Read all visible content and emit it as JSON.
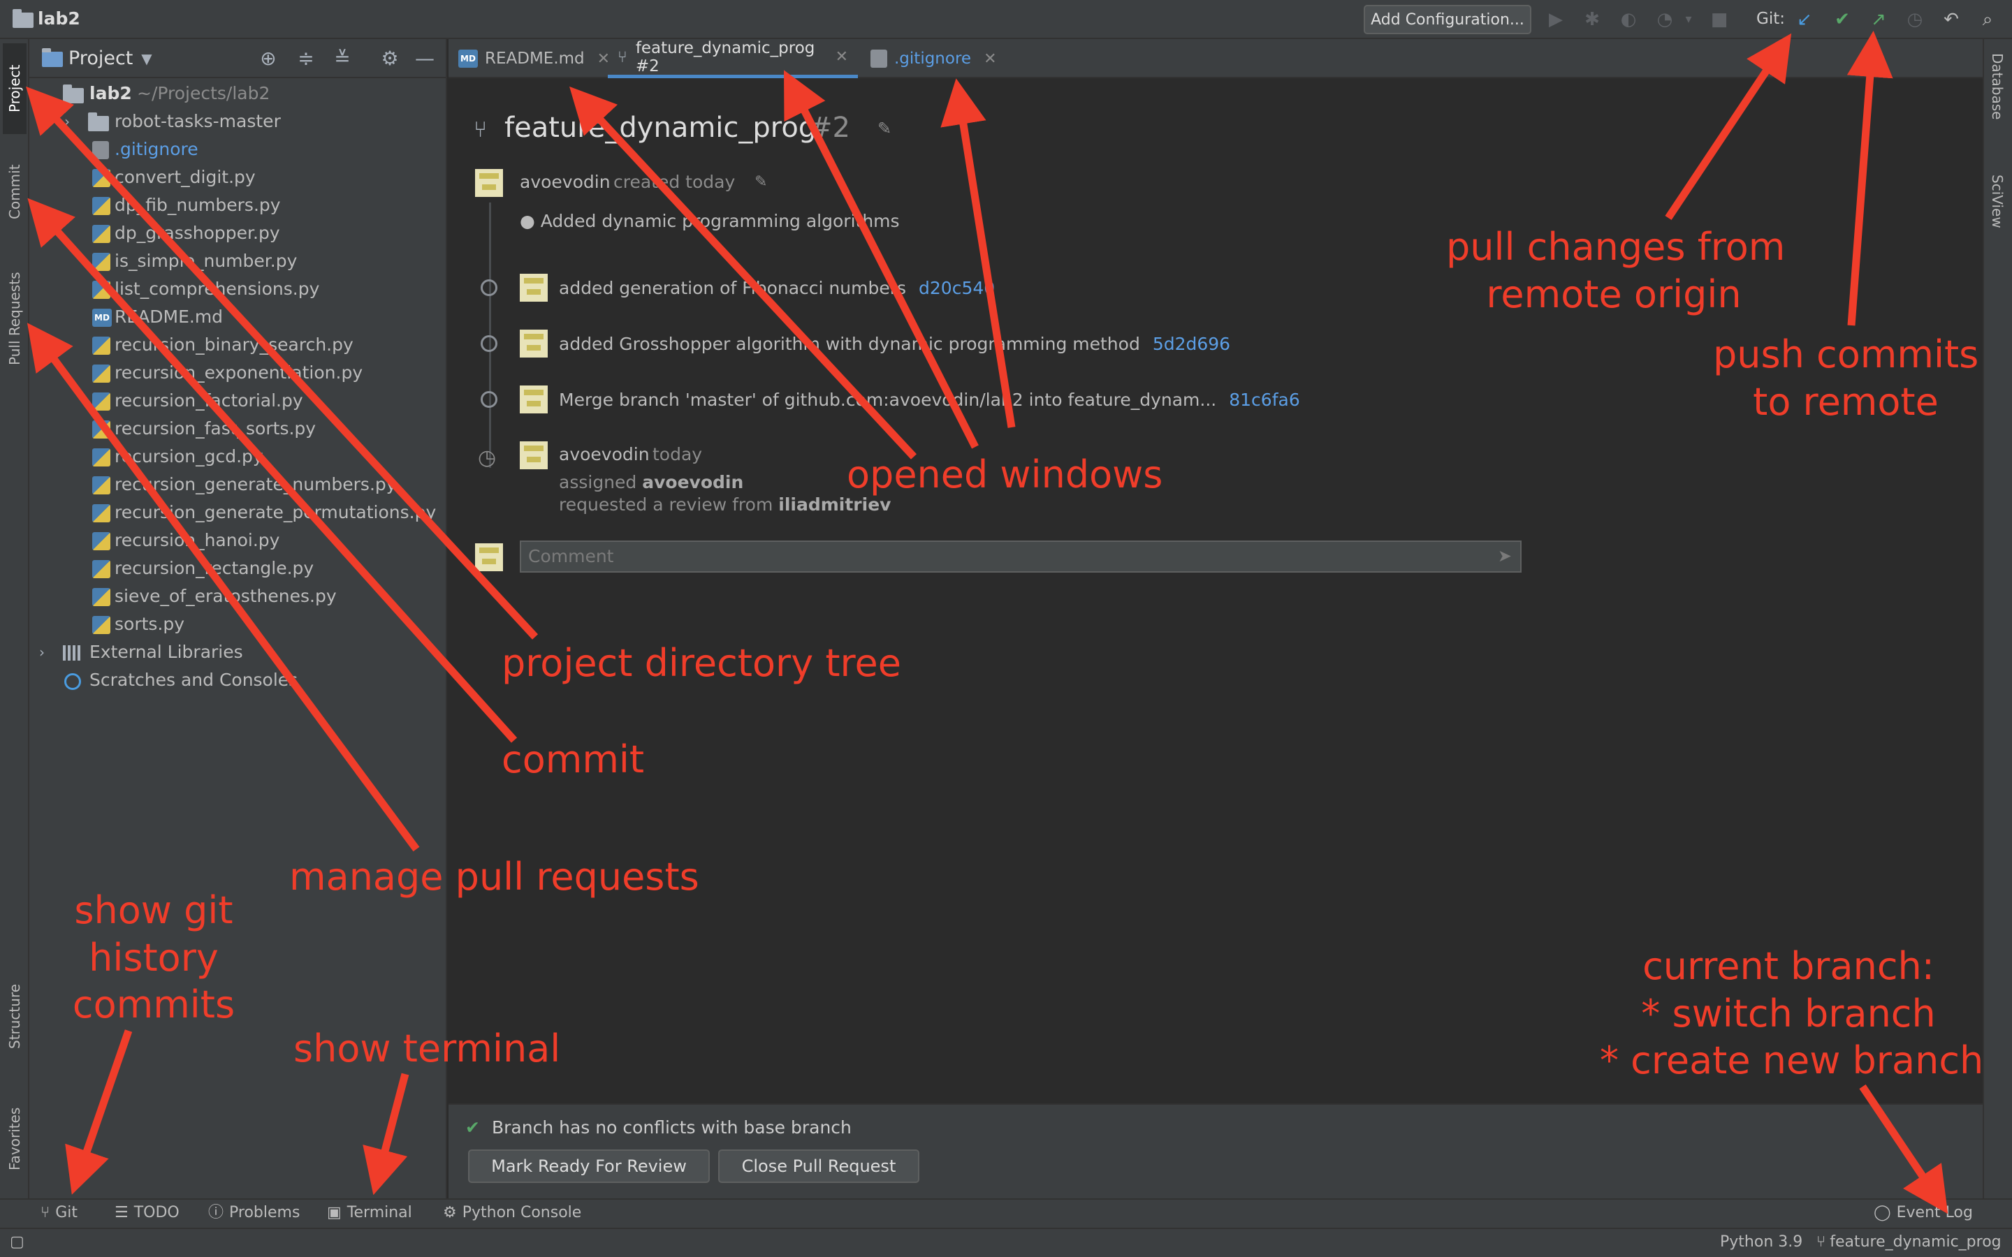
{
  "window": {
    "project_title": "lab2"
  },
  "toolbar": {
    "add_configuration": "Add Configuration...",
    "git_label": "Git:"
  },
  "left_tabs": [
    "Project",
    "Commit",
    "Pull Requests",
    "Structure",
    "Favorites"
  ],
  "right_tabs": [
    "Database",
    "SciView"
  ],
  "project_panel": {
    "title": "Project",
    "root_name": "lab2",
    "root_path": "~/Projects/lab2",
    "folder": "robot-tasks-master",
    "files": [
      ".gitignore",
      "convert_digit.py",
      "dp_fib_numbers.py",
      "dp_grasshopper.py",
      "is_simple_number.py",
      "list_comprehensions.py",
      "README.md",
      "recursion_binary_search.py",
      "recursion_exponentiation.py",
      "recursion_factorial.py",
      "recursion_fast_sorts.py",
      "recursion_gcd.py",
      "recursion_generate_numbers.py",
      "recursion_generate_permutations.py",
      "recursion_hanoi.py",
      "recursion_rectangle.py",
      "sieve_of_eratosthenes.py",
      "sorts.py"
    ],
    "external_libraries": "External Libraries",
    "scratches": "Scratches and Consoles"
  },
  "tabs": [
    {
      "label": "README.md"
    },
    {
      "label": "feature_dynamic_prog #2"
    },
    {
      "label": ".gitignore"
    }
  ],
  "pull_request": {
    "title": "feature_dynamic_prog",
    "number": "#2",
    "author": "avoevodin",
    "created": "created today",
    "description": "Added dynamic programming algorithms",
    "commits": [
      {
        "message": "added generation of Fibonacci numbers",
        "hash": "d20c540"
      },
      {
        "message": "added Grosshopper algorithm with dynamic programming method",
        "hash": "5d2d696"
      },
      {
        "message": "Merge branch 'master' of github.com:avoevodin/lab2 into feature_dynam...",
        "hash": "81c6fa6"
      }
    ],
    "event_user": "avoevodin",
    "event_time": "today",
    "assigned_prefix": "assigned",
    "assigned_user": "avoevodin",
    "review_prefix": "requested a review from",
    "reviewer": "iliadmitriev",
    "comment_placeholder": "Comment",
    "conflict_status": "Branch has no conflicts with base branch",
    "mark_ready": "Mark Ready For Review",
    "close_pr": "Close Pull Request"
  },
  "bottom_tools": [
    "Git",
    "TODO",
    "Problems",
    "Terminal",
    "Python Console"
  ],
  "event_log": "Event Log",
  "status": {
    "interpreter": "Python 3.9",
    "branch": "feature_dynamic_prog"
  },
  "annotations": {
    "project_tree": "project directory tree",
    "commit": "commit",
    "pull_requests": "manage pull requests",
    "git_history": [
      "show git",
      "history",
      "commits"
    ],
    "terminal": "show terminal",
    "opened_windows": "opened windows",
    "pull": [
      "pull changes from",
      "remote origin"
    ],
    "push": [
      "push commits",
      "to remote"
    ],
    "branch": [
      "current branch:",
      "* switch branch",
      "* create new branch"
    ]
  },
  "colors": {
    "annotation": "#f03d2a",
    "link": "#5c9fe6",
    "accent_tab": "#4a88c7",
    "success": "#59a869"
  }
}
